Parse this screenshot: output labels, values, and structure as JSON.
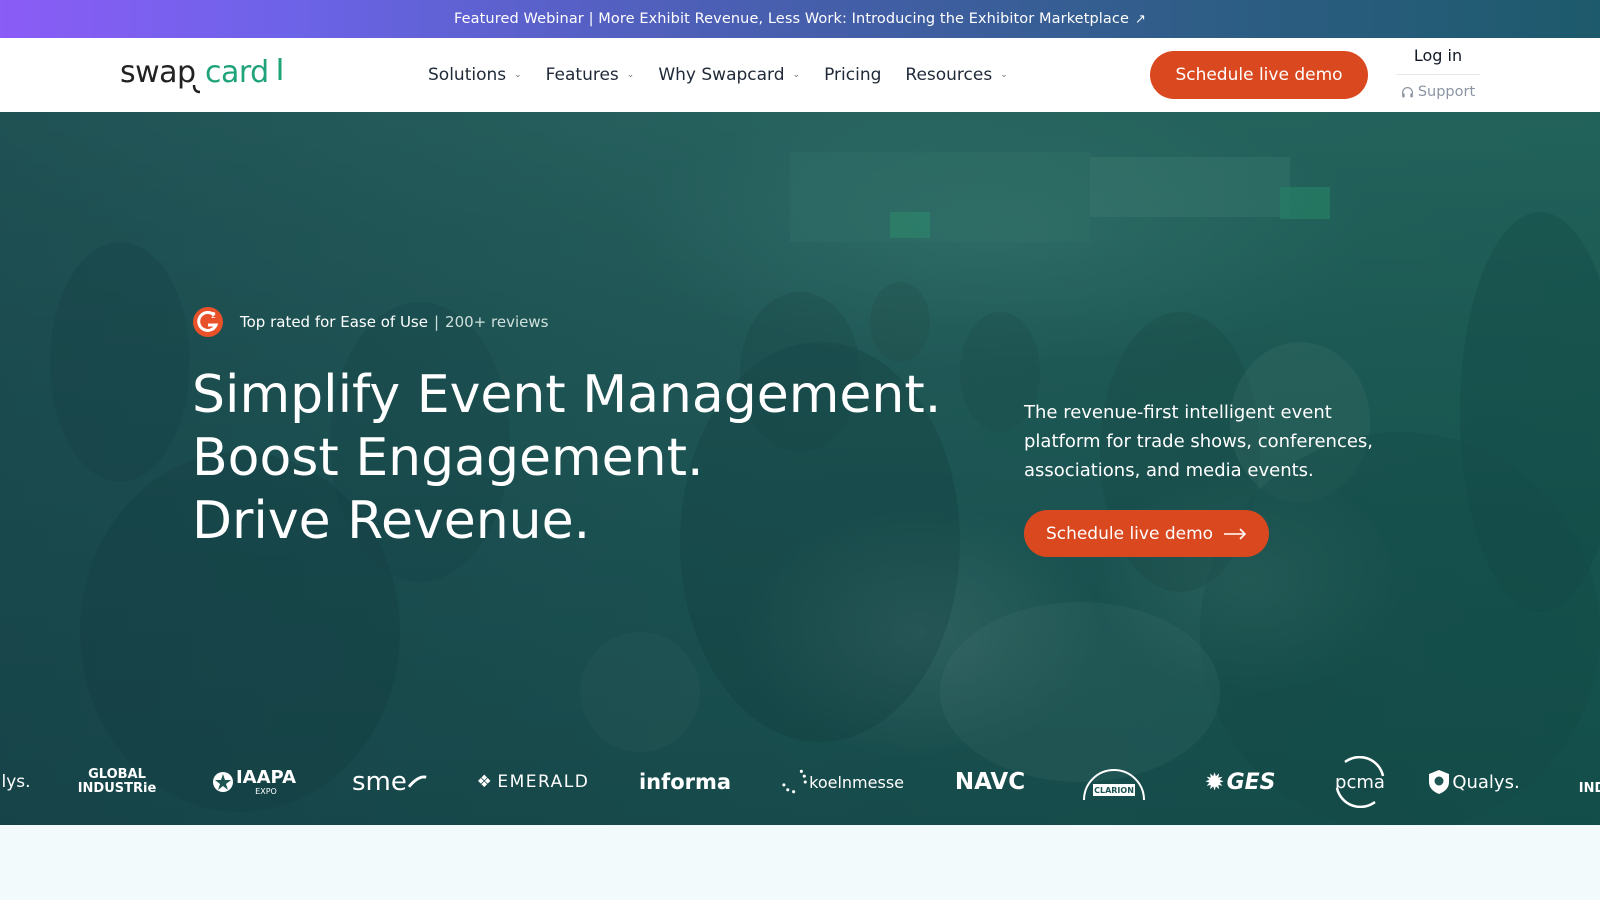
{
  "promo": {
    "text": "Featured Webinar | More Exhibit Revenue, Less Work: Introducing the Exhibitor Marketplace",
    "arrow": "↗"
  },
  "header": {
    "logo_text": "swapcard",
    "nav": [
      {
        "label": "Solutions",
        "has_dropdown": true
      },
      {
        "label": "Features",
        "has_dropdown": true
      },
      {
        "label": "Why Swapcard",
        "has_dropdown": true
      },
      {
        "label": "Pricing",
        "has_dropdown": false
      },
      {
        "label": "Resources",
        "has_dropdown": true
      }
    ],
    "cta_label": "Schedule live demo",
    "login_label": "Log in",
    "support_label": "Support"
  },
  "hero": {
    "rating_text": "Top rated for Ease of Use",
    "rating_separator": "|",
    "reviews_text": "200+ reviews",
    "headline": [
      "Simplify Event Management.",
      "Boost Engagement.",
      "Drive Revenue."
    ],
    "subtext": "The revenue-first intelligent event platform for trade shows, conferences, associations, and media events.",
    "cta_label": "Schedule live demo"
  },
  "logos": {
    "qualys_partial": "lys.",
    "global_industrie": [
      "GLOBAL",
      "INDUSTRie"
    ],
    "iaapa": "IAAPA",
    "iaapa_sub": "EXPO",
    "sme": "sme",
    "emerald": "EMERALD",
    "informa": "informa",
    "koelnmesse": "koelnmesse",
    "navc": "NAVC",
    "clarion": "CLARION",
    "ges": "GES",
    "pcma": "pcma",
    "qualys": "Qualys.",
    "ind_partial": "IND"
  },
  "colors": {
    "brand_orange": "#d9481f",
    "brand_teal": "#1fa37a",
    "hero_teal": "#1d5553"
  }
}
